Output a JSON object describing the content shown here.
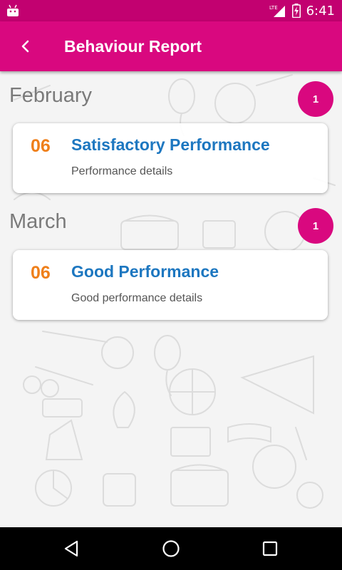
{
  "status_bar": {
    "time": "6:41",
    "network": "LTE",
    "icons": [
      "android-icon",
      "signal-icon",
      "battery-charging-icon"
    ]
  },
  "header": {
    "title": "Behaviour Report",
    "back_icon": "chevron-left-icon",
    "color": "#d9087f"
  },
  "months": [
    {
      "name": "February",
      "count": "1",
      "reports": [
        {
          "day": "06",
          "title": "Satisfactory Performance",
          "detail": "Performance details"
        }
      ]
    },
    {
      "name": "March",
      "count": "1",
      "reports": [
        {
          "day": "06",
          "title": "Good Performance",
          "detail": "Good performance details"
        }
      ]
    }
  ],
  "colors": {
    "accent": "#d9087f",
    "status_bar": "#c20170",
    "day": "#ef7f1a",
    "report_title": "#1d77c0",
    "month": "#7a7a7a"
  },
  "nav_bar": {
    "icons": [
      "back-triangle-icon",
      "home-circle-icon",
      "recents-square-icon"
    ]
  }
}
